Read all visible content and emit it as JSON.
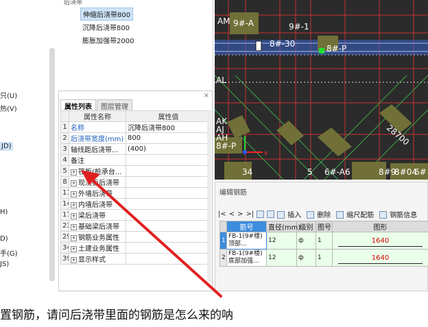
{
  "left_menu": {
    "items": [
      {
        "label": "只(U)",
        "selected": false
      },
      {
        "label": "热(V)",
        "selected": false
      },
      {
        "label": "JD)",
        "selected": true
      },
      {
        "label": "H)",
        "selected": false
      },
      {
        "label": "D)",
        "selected": false
      },
      {
        "label": "手(G)",
        "selected": false
      },
      {
        "label": "JS)",
        "selected": false
      }
    ]
  },
  "tree": {
    "root_label": "后浇带",
    "items": [
      {
        "label": "伸缩后浇带800",
        "selected": true
      },
      {
        "label": "沉降后浇带800",
        "selected": false
      },
      {
        "label": "膨胀加强带2000",
        "selected": false
      }
    ]
  },
  "properties": {
    "close": "×",
    "tabs": [
      {
        "label": "属性列表",
        "active": true
      },
      {
        "label": "图层管理",
        "active": false
      }
    ],
    "headers": {
      "name": "属性名称",
      "value": "属性值"
    },
    "rows": [
      {
        "num": "1",
        "name": "名称",
        "value": "沉降后浇带800",
        "blue": true,
        "expand": false
      },
      {
        "num": "2",
        "name": "后浇带宽度(mm)",
        "value": "800",
        "blue": true,
        "expand": false
      },
      {
        "num": "3",
        "name": "轴线距后浇带...",
        "value": "(400)",
        "blue": false,
        "expand": false
      },
      {
        "num": "4",
        "name": "备注",
        "value": "",
        "blue": false,
        "expand": false
      },
      {
        "num": "5",
        "name": "筏板(桩承台...",
        "value": "",
        "blue": false,
        "expand": true
      },
      {
        "num": "8",
        "name": "现浇板后浇带",
        "value": "",
        "blue": false,
        "expand": true
      },
      {
        "num": "11",
        "name": "外墙后浇带",
        "value": "",
        "blue": false,
        "expand": true
      },
      {
        "num": "14",
        "name": "内墙后浇带",
        "value": "",
        "blue": false,
        "expand": true
      },
      {
        "num": "17",
        "name": "梁后浇带",
        "value": "",
        "blue": false,
        "expand": true
      },
      {
        "num": "23",
        "name": "基础梁后浇带",
        "value": "",
        "blue": false,
        "expand": true
      },
      {
        "num": "29",
        "name": "钢筋业务属性",
        "value": "",
        "blue": false,
        "expand": true
      },
      {
        "num": "34",
        "name": "土建业务属性",
        "value": "",
        "blue": false,
        "expand": true
      },
      {
        "num": "39",
        "name": "显示样式",
        "value": "",
        "blue": false,
        "expand": true
      }
    ]
  },
  "cad": {
    "labels": [
      "AM",
      "9#-A",
      "9#-1",
      "8#-30",
      "8#-P",
      "AL",
      "AK",
      "AJ",
      "AH",
      "8#-P",
      "28700",
      "34",
      "5",
      "6#-A6",
      "8#9",
      "8#04",
      "6#"
    ]
  },
  "rebar": {
    "title": "编辑钢筋",
    "nav": [
      "|<",
      "<",
      ">",
      ">|"
    ],
    "toolbar": {
      "insert": "插入",
      "delete": "删除",
      "ruler": "缩尺配筋",
      "info": "钢筋信息"
    },
    "headers": {
      "name": "筋号",
      "diameter": "直径(mm)",
      "grade": "级别",
      "fig": "图号",
      "shape": "图形"
    },
    "rows": [
      {
        "num": "1",
        "name": "FB-1(9#楼) 顶部...",
        "diameter": "12",
        "grade": "ф",
        "fig": "1",
        "shape_value": "1640",
        "selected": true
      },
      {
        "num": "2",
        "name": "FB-1(9#楼) 底部加强...",
        "diameter": "12",
        "grade": "ф",
        "fig": "1",
        "shape_value": "1640",
        "selected": false
      }
    ]
  },
  "question": "置钢筋，请问后浇带里面的钢筋是怎么来的呐",
  "colors": {
    "arrow": "#e02020",
    "cad_background": "#2b2b2b",
    "selection": "#3c8ddd"
  }
}
